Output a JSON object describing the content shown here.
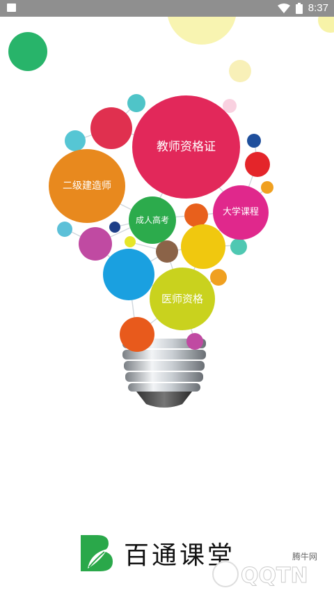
{
  "status_bar": {
    "time": "8:37"
  },
  "bubbles": {
    "teacher_cert": "教师资格证",
    "builder_level2": "二级建造师",
    "adult_exam": "成人高考",
    "college_course": "大学课程",
    "medical_cert": "医师资格"
  },
  "brand": {
    "name": "百通课堂"
  },
  "watermark": {
    "text": "QQTN",
    "small_text": "腾牛网"
  },
  "colors": {
    "status_bar": "#8f8f8f",
    "brand_green": "#2aa84a"
  }
}
